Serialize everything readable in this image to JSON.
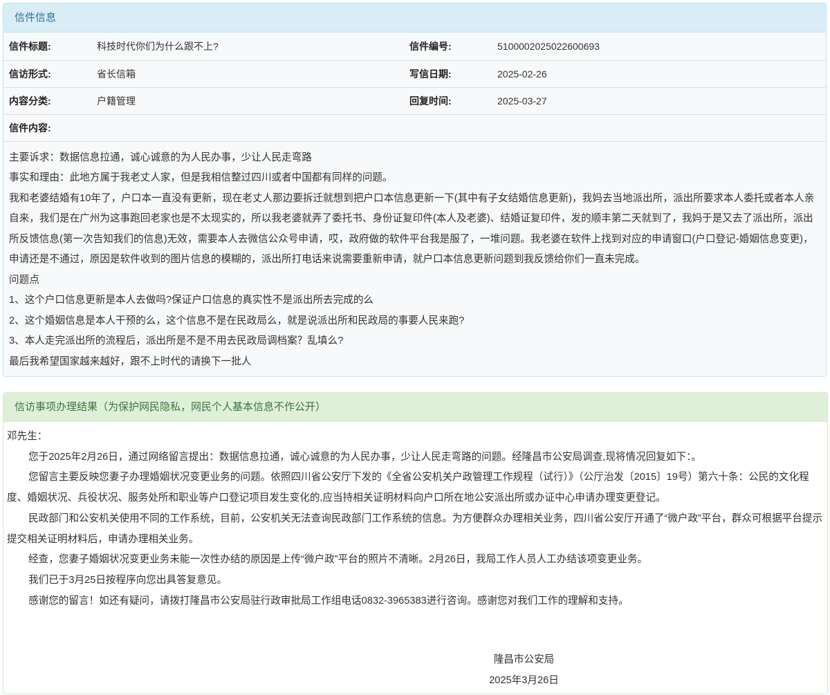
{
  "letter_panel": {
    "title": "信件信息",
    "fields": {
      "subject_label": "信件标题:",
      "subject_value": "科技时代你们为什么跟不上?",
      "number_label": "信件编号:",
      "number_value": "5100002025022600693",
      "type_label": "信访形式:",
      "type_value": "省长信箱",
      "date_label": "写信日期:",
      "date_value": "2025-02-26",
      "category_label": "内容分类:",
      "category_value": "户籍管理",
      "reply_time_label": "回复时间:",
      "reply_time_value": "2025-03-27",
      "content_label": "信件内容:"
    },
    "content": [
      "主要诉求：数据信息拉通，诚心诚意的为人民办事，少让人民走弯路",
      "事实和理由：此地方属于我老丈人家，但是我相信整过四川或者中国都有同样的问题。",
      "我和老婆结婚有10年了，户口本一直没有更新，现在老丈人那边要拆迁就想到把户口本信息更新一下(其中有子女结婚信息更新)，我妈去当地派出所，派出所要求本人委托或者本人亲自来，我们是在广州为这事跑回老家也是不太现实的，所以我老婆就弄了委托书、身份证复印件(本人及老婆)、结婚证复印件，发的顺丰第二天就到了，我妈于是又去了派出所，派出所反馈信息(第一次告知我们的信息)无效，需要本人去微信公众号申请，哎，政府做的软件平台我是服了，一堆问题。我老婆在软件上找到对应的申请窗口(户口登记-婚姻信息变更)，申请还是不通过，原因是软件收到的图片信息的模糊的，派出所打电话来说需要重新申请，就户口本信息更新问题到我反馈给你们一直未完成。",
      "问题点",
      "1、这个户口信息更新是本人去做吗?保证户口信息的真实性不是派出所去完成的么",
      "2、这个婚姻信息是本人干预的么，这个信息不是在民政局么，就是说派出所和民政局的事要人民来跑?",
      "3、本人走完派出所的流程后，派出所是不是不用去民政局调档案？乱填么?",
      "最后我希望国家越来越好，跟不上时代的请换下一批人"
    ]
  },
  "reply_panel": {
    "title": "信访事项办理结果（为保护网民隐私，网民个人基本信息不作公开）",
    "greeting": "邓先生：",
    "paragraphs": [
      "您于2025年2月26日，通过网络留言提出：数据信息拉通，诚心诚意的为人民办事，少让人民走弯路的问题。经隆昌市公安局调查,现将情况回复如下：。",
      "您留言主要反映您妻子办理婚姻状况变更业务的问题。依照四川省公安厅下发的《全省公安机关户政管理工作规程（试行）》（公厅治发〔2015〕19号）第六十条：公民的文化程度、婚姻状况、兵役状况、服务处所和职业等户口登记项目发生变化的,应当持相关证明材料向户口所在地公安派出所或办证中心申请办理变更登记。",
      "民政部门和公安机关使用不同的工作系统，目前，公安机关无法查询民政部门工作系统的信息。为方便群众办理相关业务，四川省公安厅开通了“微户政”平台，群众可根据平台提示提交相关证明材料后，申请办理相关业务。",
      "经查，您妻子婚姻状况变更业务未能一次性办结的原因是上传“微户政”平台的照片不清晰。2月26日，我局工作人员人工办结该项变更业务。",
      "我们已于3月25日按程序向您出具答复意见。",
      "感谢您的留言！如还有疑问，请拨打隆昌市公安局驻行政审批局工作组电话0832-3965383进行咨询。感谢您对我们工作的理解和支持。"
    ],
    "signature": "隆昌市公安局",
    "sign_date": "2025年3月26日"
  }
}
